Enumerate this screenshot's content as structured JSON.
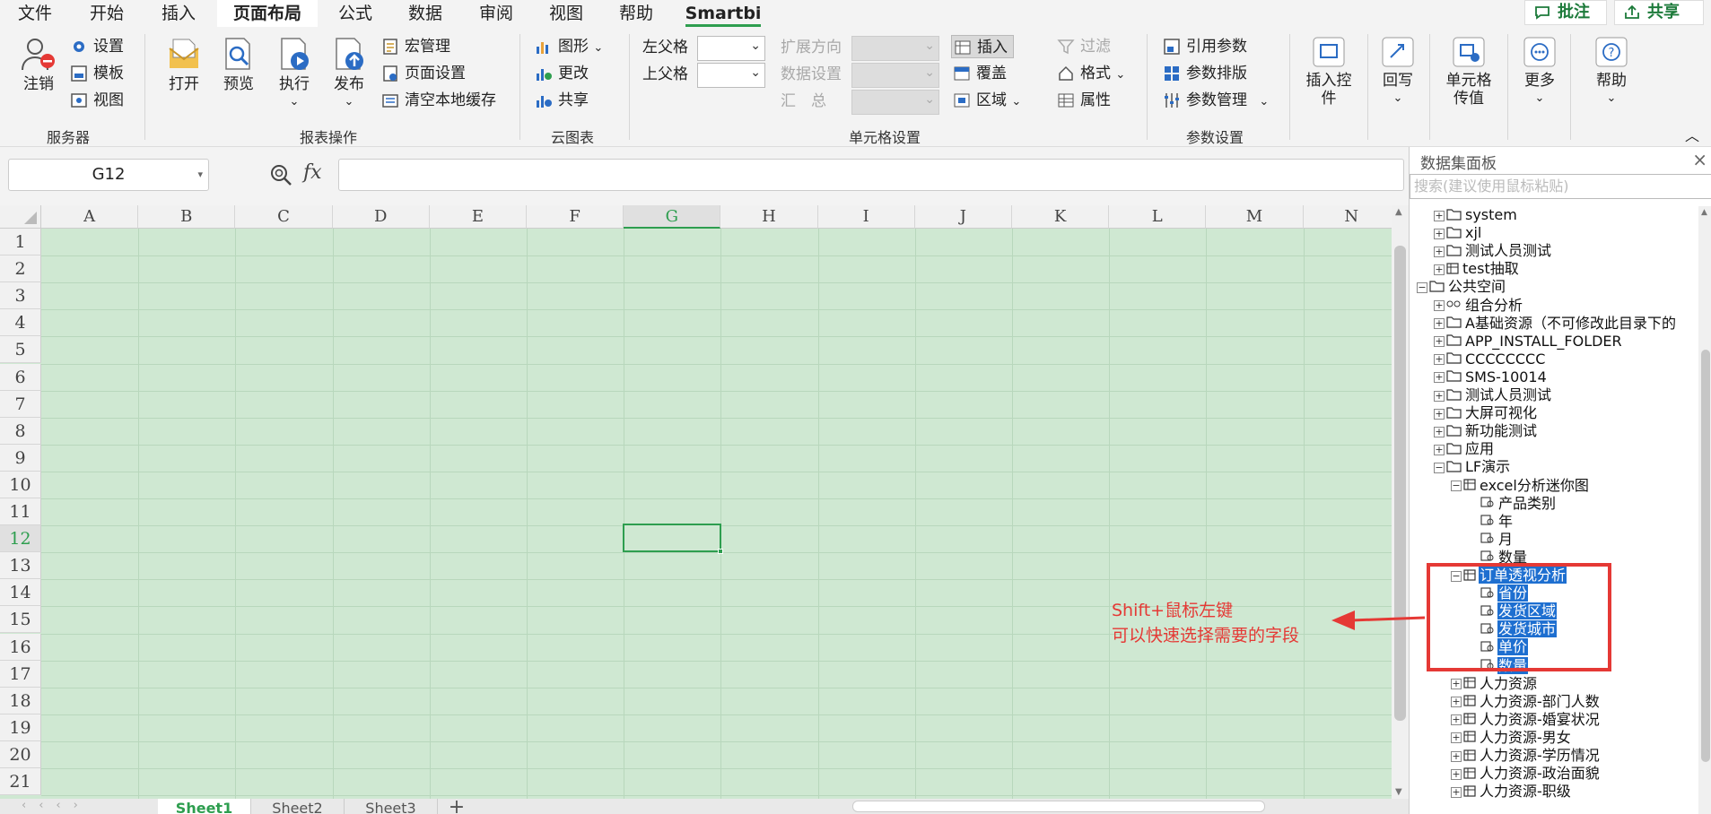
{
  "menu": [
    "文件",
    "开始",
    "插入",
    "页面布局",
    "公式",
    "数据",
    "审阅",
    "视图",
    "帮助",
    "Smartbi"
  ],
  "top_buttons": {
    "comment": "批注",
    "share": "共享"
  },
  "ribbon": {
    "server": {
      "label": "服务器",
      "logout": "注销",
      "settings": "设置",
      "template": "模板",
      "view": "视图"
    },
    "report": {
      "label": "报表操作",
      "open": "打开",
      "preview": "预览",
      "execute": "执行",
      "publish": "发布",
      "macro": "宏管理",
      "page_setup": "页面设置",
      "clear_cache": "清空本地缓存"
    },
    "cloud": {
      "label": "云图表",
      "chart": "图形",
      "change": "更改",
      "share": "共享"
    },
    "cell": {
      "label": "单元格设置",
      "left_parent": "左父格",
      "top_parent": "上父格",
      "expand": "扩展方向",
      "data_setting": "数据设置",
      "sum": "汇　总",
      "insert": "插入",
      "cover": "覆盖",
      "region": "区域",
      "filter": "过滤",
      "format": "格式",
      "attr": "属性"
    },
    "param": {
      "label": "参数设置",
      "ref_param": "引用参数",
      "param_layout": "参数排版",
      "param_mgr": "参数管理"
    },
    "insert_ctrl": "插入控件",
    "writeback": "回写",
    "cell_pass": "单元格传值",
    "more": "更多",
    "help": "帮助"
  },
  "formula": {
    "cell_ref": "G12",
    "fx": "fx"
  },
  "columns": [
    "A",
    "B",
    "C",
    "D",
    "E",
    "F",
    "G",
    "H",
    "I",
    "J",
    "K",
    "L",
    "M",
    "N"
  ],
  "rows": [
    "1",
    "2",
    "3",
    "4",
    "5",
    "6",
    "7",
    "8",
    "9",
    "10",
    "11",
    "12",
    "13",
    "14",
    "15",
    "16",
    "17",
    "18",
    "19",
    "20",
    "21"
  ],
  "sheets": [
    "Sheet1",
    "Sheet2",
    "Sheet3",
    "+"
  ],
  "panel": {
    "title": "数据集面板",
    "search_placeholder": "搜索(建议使用鼠标粘贴)",
    "tree": [
      {
        "depth": 1,
        "exp": "+",
        "icon": "folder",
        "label": "system"
      },
      {
        "depth": 1,
        "exp": "+",
        "icon": "folder",
        "label": "xjl"
      },
      {
        "depth": 1,
        "exp": "+",
        "icon": "folder",
        "label": "测试人员测试"
      },
      {
        "depth": 1,
        "exp": "+",
        "icon": "dataset",
        "label": "test抽取"
      },
      {
        "depth": 0,
        "exp": "-",
        "icon": "folder",
        "label": "公共空间"
      },
      {
        "depth": 1,
        "exp": "+",
        "icon": "group",
        "label": "组合分析"
      },
      {
        "depth": 1,
        "exp": "+",
        "icon": "folder",
        "label": "A基础资源（不可修改此目录下的"
      },
      {
        "depth": 1,
        "exp": "+",
        "icon": "folder",
        "label": "APP_INSTALL_FOLDER"
      },
      {
        "depth": 1,
        "exp": "+",
        "icon": "folder",
        "label": "CCCCCCCC"
      },
      {
        "depth": 1,
        "exp": "+",
        "icon": "folder",
        "label": "SMS-10014"
      },
      {
        "depth": 1,
        "exp": "+",
        "icon": "folder",
        "label": "测试人员测试"
      },
      {
        "depth": 1,
        "exp": "+",
        "icon": "folder",
        "label": "大屏可视化"
      },
      {
        "depth": 1,
        "exp": "+",
        "icon": "folder",
        "label": "新功能测试"
      },
      {
        "depth": 1,
        "exp": "+",
        "icon": "folder",
        "label": "应用"
      },
      {
        "depth": 1,
        "exp": "-",
        "icon": "folder",
        "label": "LF演示"
      },
      {
        "depth": 2,
        "exp": "-",
        "icon": "dataset",
        "label": "excel分析迷你图"
      },
      {
        "depth": 3,
        "exp": "",
        "icon": "field",
        "label": "产品类别"
      },
      {
        "depth": 3,
        "exp": "",
        "icon": "field",
        "label": "年"
      },
      {
        "depth": 3,
        "exp": "",
        "icon": "field",
        "label": "月"
      },
      {
        "depth": 3,
        "exp": "",
        "icon": "field",
        "label": "数量"
      },
      {
        "depth": 2,
        "exp": "-",
        "icon": "dataset",
        "label": "订单透视分析",
        "hl": true
      },
      {
        "depth": 3,
        "exp": "",
        "icon": "field",
        "label": "省份",
        "hl": true
      },
      {
        "depth": 3,
        "exp": "",
        "icon": "field",
        "label": "发货区域",
        "hl": true
      },
      {
        "depth": 3,
        "exp": "",
        "icon": "field",
        "label": "发货城市",
        "hl": true
      },
      {
        "depth": 3,
        "exp": "",
        "icon": "field",
        "label": "单价",
        "hl": true
      },
      {
        "depth": 3,
        "exp": "",
        "icon": "field",
        "label": "数量",
        "hl": true
      },
      {
        "depth": 2,
        "exp": "+",
        "icon": "dataset",
        "label": "人力资源"
      },
      {
        "depth": 2,
        "exp": "+",
        "icon": "dataset",
        "label": "人力资源-部门人数"
      },
      {
        "depth": 2,
        "exp": "+",
        "icon": "dataset",
        "label": "人力资源-婚宴状况"
      },
      {
        "depth": 2,
        "exp": "+",
        "icon": "dataset",
        "label": "人力资源-男女"
      },
      {
        "depth": 2,
        "exp": "+",
        "icon": "dataset",
        "label": "人力资源-学历情况"
      },
      {
        "depth": 2,
        "exp": "+",
        "icon": "dataset",
        "label": "人力资源-政治面貌"
      },
      {
        "depth": 2,
        "exp": "+",
        "icon": "dataset",
        "label": "人力资源-职级"
      }
    ]
  },
  "annotation": {
    "line1": "Shift+鼠标左键",
    "line2": "可以快速选择需要的字段",
    "color": "#e53935"
  },
  "colors": {
    "accent": "#2e9e4f",
    "highlight": "#1e6fd0",
    "grid_bg": "#cfe8d2"
  }
}
